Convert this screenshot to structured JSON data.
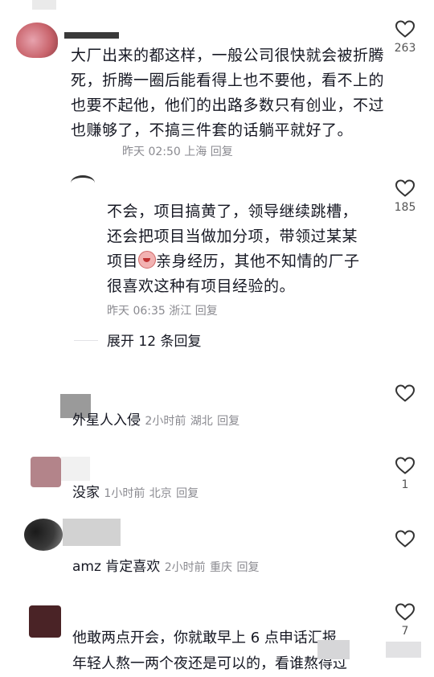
{
  "comments": [
    {
      "text": "大厂出来的都这样，一般公司很快就会被折腾死，折腾一圈后能看得上也不要他，看不上的也要不起他，他们的出路多数只有创业，不过也赚够了，不搞三件套的话躺平就好了。",
      "time": "昨天 02:50",
      "location": "上海",
      "reply": "回复",
      "likes": "263"
    },
    {
      "text_part1": "不会，项目搞黄了，领导继续跳槽，还会把项目当做加分项，带领过某某项目",
      "text_part2": "亲身经历，其他不知情的厂子很喜欢这种有项目经验的。",
      "time": "昨天 06:35",
      "location": "浙江",
      "reply": "回复",
      "likes": "185",
      "expand": "展开 12 条回复"
    },
    {
      "text": "外星人入侵",
      "time": "2小时前",
      "location": "湖北",
      "reply": "回复",
      "likes": ""
    },
    {
      "text": "没家",
      "time": "1小时前",
      "location": "北京",
      "reply": "回复",
      "likes": "1"
    },
    {
      "text": "amz 肯定喜欢",
      "time": "2小时前",
      "location": "重庆",
      "reply": "回复",
      "likes": ""
    },
    {
      "text_line1": "他敢两点开会，你就敢早上 6 点申话汇报",
      "text_line2": "年轻人熬一两个夜还是可以的，看谁熬得过",
      "likes": "7"
    }
  ],
  "colors": {
    "text": "#161823",
    "meta": "#8a8a90",
    "accent_avatar_1": "#c9646c",
    "accent_avatar_2": "#b3848a",
    "accent_avatar_3": "#4a2326"
  }
}
